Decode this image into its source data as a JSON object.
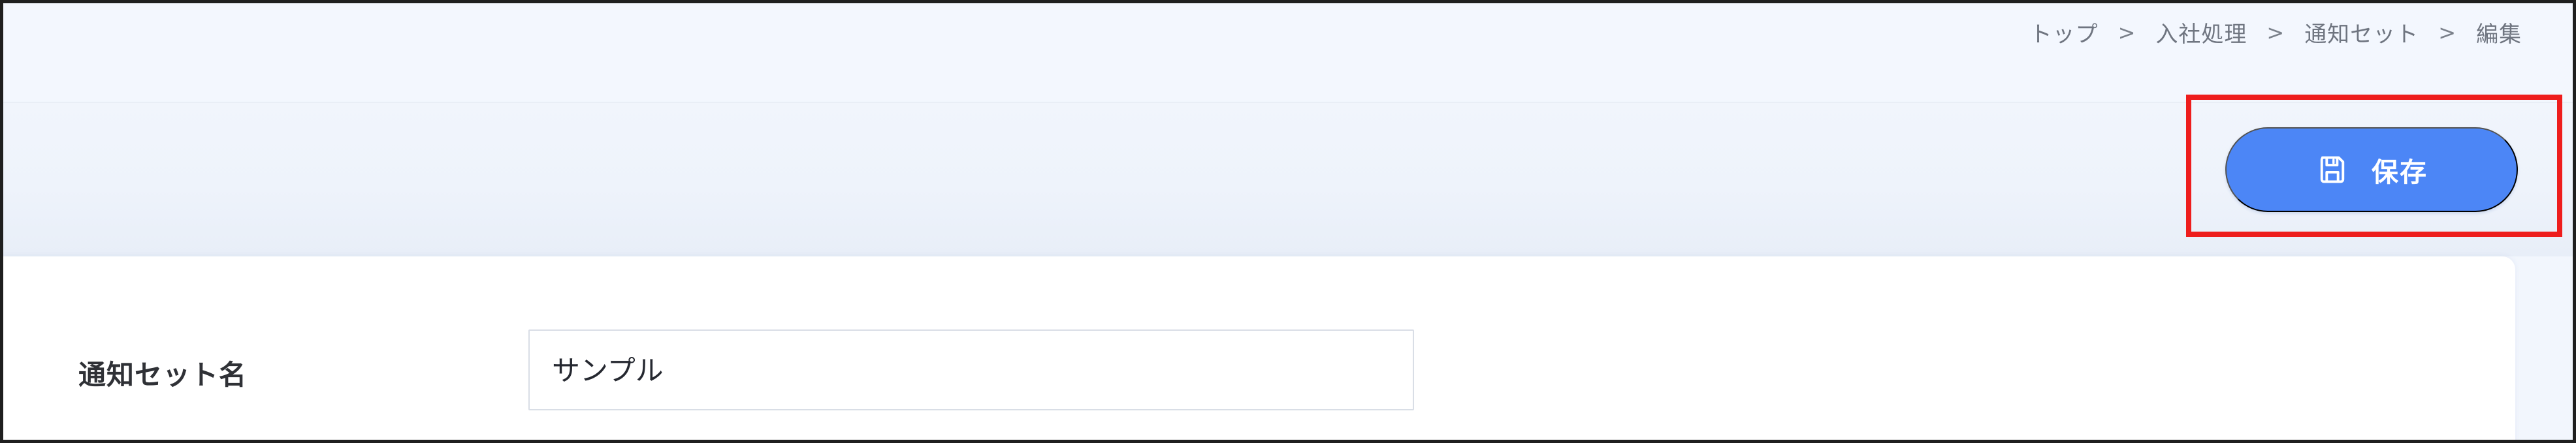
{
  "breadcrumb": {
    "items": [
      {
        "label": "トップ"
      },
      {
        "label": "入社処理"
      },
      {
        "label": "通知セット"
      },
      {
        "label": "編集"
      }
    ],
    "separator": ">"
  },
  "toolbar": {
    "save_label": "保存",
    "save_icon": "floppy-disk-icon"
  },
  "form": {
    "notification_set_name_label": "通知セット名",
    "notification_set_name_value": "サンプル"
  },
  "colors": {
    "page_background": "#f2f6fd",
    "primary_button": "#4c86f6",
    "highlight_border": "#ee1d1d",
    "card_background": "#ffffff"
  }
}
